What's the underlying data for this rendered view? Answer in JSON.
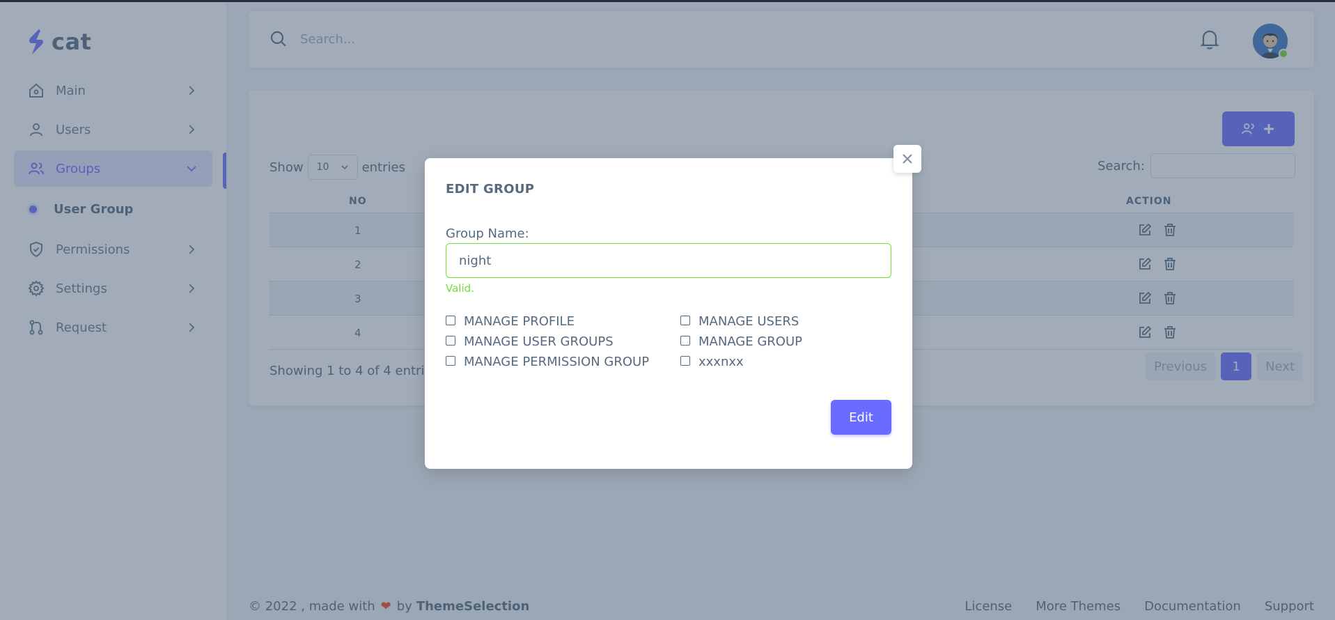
{
  "brand": {
    "name": "cat"
  },
  "sidebar": {
    "items": [
      {
        "label": "Main",
        "icon": "home-icon"
      },
      {
        "label": "Users",
        "icon": "user-icon"
      },
      {
        "label": "Groups",
        "icon": "users-icon"
      },
      {
        "label": "User Group",
        "icon": "dot"
      },
      {
        "label": "Permissions",
        "icon": "shield-icon"
      },
      {
        "label": "Settings",
        "icon": "gear-icon"
      },
      {
        "label": "Request",
        "icon": "git-pull-icon"
      }
    ]
  },
  "navbar": {
    "search_placeholder": "Search..."
  },
  "table": {
    "show_label": "Show",
    "entries_label": "entries",
    "page_size": "10",
    "search_label": "Search:",
    "columns": [
      "NO",
      "ACTION"
    ],
    "rows": [
      {
        "no": "1"
      },
      {
        "no": "2"
      },
      {
        "no": "3"
      },
      {
        "no": "4"
      }
    ],
    "info": "Showing 1 to 4 of 4 entries",
    "pager": {
      "previous": "Previous",
      "current": "1",
      "next": "Next"
    }
  },
  "footer": {
    "copyright": "© 2022 , made with",
    "by": "by",
    "author": "ThemeSelection",
    "links": [
      "License",
      "More Themes",
      "Documentation",
      "Support"
    ]
  },
  "modal": {
    "title": "EDIT GROUP",
    "group_name_label": "Group Name:",
    "group_name_value": "night",
    "valid_text": "Valid.",
    "permissions": [
      "MANAGE PROFILE",
      "MANAGE USERS",
      "MANAGE USER GROUPS",
      "MANAGE GROUP",
      "MANAGE PERMISSION GROUP",
      "xxxnxx"
    ],
    "submit_label": "Edit"
  },
  "colors": {
    "primary": "#696cff",
    "valid": "#71dd37",
    "text": "#566a7f"
  }
}
